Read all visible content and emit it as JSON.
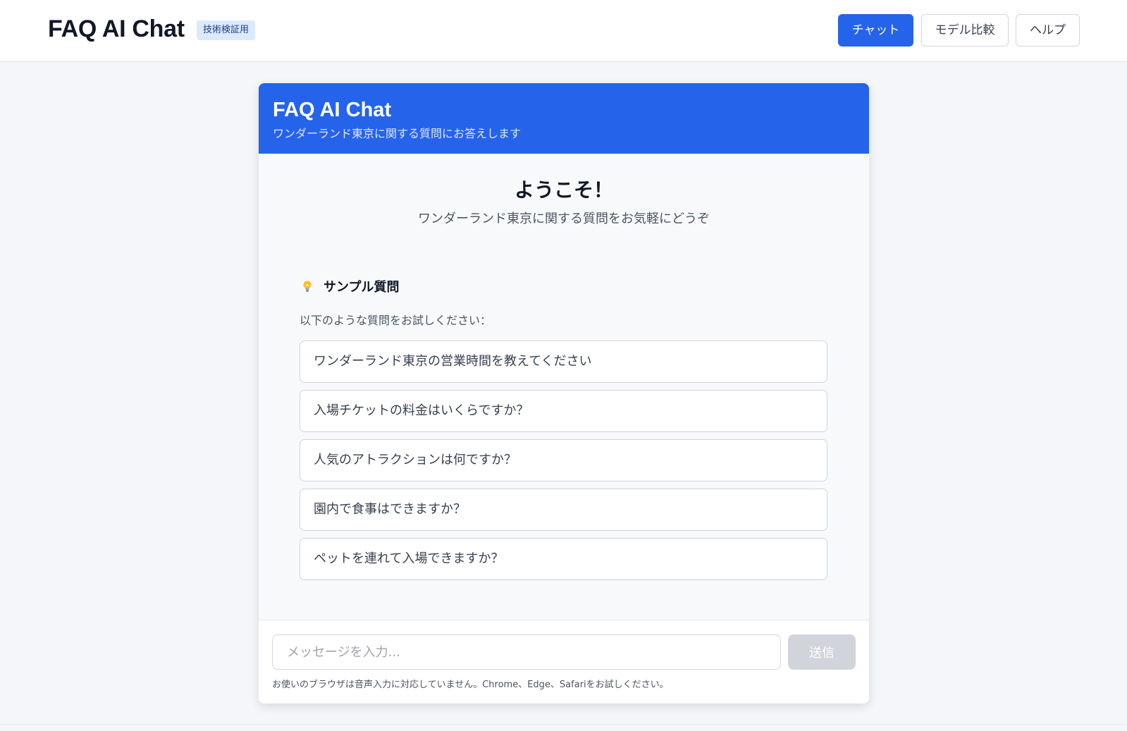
{
  "topbar": {
    "brand": "FAQ AI Chat",
    "badge": "技術検証用",
    "nav": [
      {
        "label": "チャット",
        "active": true
      },
      {
        "label": "モデル比較",
        "active": false
      },
      {
        "label": "ヘルプ",
        "active": false
      }
    ]
  },
  "chat": {
    "title": "FAQ AI Chat",
    "subtitle": "ワンダーランド東京に関する質問にお答えします",
    "welcome_title": "ようこそ！",
    "welcome_subtitle": "ワンダーランド東京に関する質問をお気軽にどうぞ",
    "samples": {
      "icon": "lightbulb-icon",
      "heading": "サンプル質問",
      "description": "以下のような質問をお試しください：",
      "items": [
        "ワンダーランド東京の営業時間を教えてください",
        "入場チケットの料金はいくらですか？",
        "人気のアトラクションは何ですか？",
        "園内で食事はできますか？",
        "ペットを連れて入場できますか？"
      ]
    },
    "input": {
      "placeholder": "メッセージを入力...",
      "value": "",
      "send_label": "送信",
      "send_disabled": true
    },
    "voice_note": "お使いのブラウザは音声入力に対応していません。Chrome、Edge、Safariをお試しください。"
  },
  "colors": {
    "accent": "#2563eb",
    "badge_bg": "#dbeafe",
    "page_bg": "#f4f6f9",
    "disabled": "#d1d5db"
  }
}
